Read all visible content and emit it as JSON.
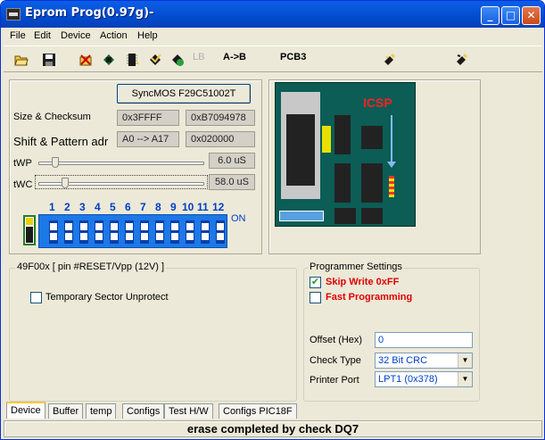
{
  "window": {
    "title": "Eprom Prog(0.97g)-",
    "min": "_",
    "max": "□",
    "close": "✕"
  },
  "menu": [
    "File",
    "Edit",
    "Device",
    "Action",
    "Help"
  ],
  "toolbar": {
    "lb_label": "LB",
    "ab_label": "A->B",
    "pcb_label": "PCB3"
  },
  "device": {
    "chip_button": "SyncMOS F29C51002T",
    "size_label": "Size & Checksum",
    "size_value": "0x3FFFF",
    "checksum_value": "0xB7094978",
    "shift_label": "Shift & Pattern adr",
    "shift_value": "A0 --> A17",
    "pattern_value": "0x020000",
    "twp_label": "tWP",
    "twp_value": "6.0 uS",
    "twc_label": "tWC",
    "twc_value": "58.0 uS",
    "dip_numbers": [
      "1",
      "2",
      "3",
      "4",
      "5",
      "6",
      "7",
      "8",
      "9",
      "10",
      "11",
      "12"
    ],
    "dip_on_label": "ON"
  },
  "pcb": {
    "icsp_label": "ICSP"
  },
  "chip_group": {
    "title": "49F00x   [ pin #RESET/Vpp (12V) ]",
    "temp_unprotect": "Temporary Sector Unprotect"
  },
  "programmer": {
    "title": "Programmer Settings",
    "skip_write": "Skip Write 0xFF",
    "skip_write_checked": true,
    "fast_prog": "Fast Programming",
    "offset_label": "Offset (Hex)",
    "offset_value": "0",
    "check_label": "Check Type",
    "check_value": "32 Bit CRC",
    "port_label": "Printer Port",
    "port_value": "LPT1 (0x378)"
  },
  "tabs": [
    "Device",
    "Buffer",
    "temp",
    "Configs",
    "Test H/W",
    "Configs PIC18F"
  ],
  "status": "erase completed by check DQ7",
  "colors": {
    "accent": "#003ec8",
    "red": "#e00000",
    "titlebar": "#0752d8"
  }
}
